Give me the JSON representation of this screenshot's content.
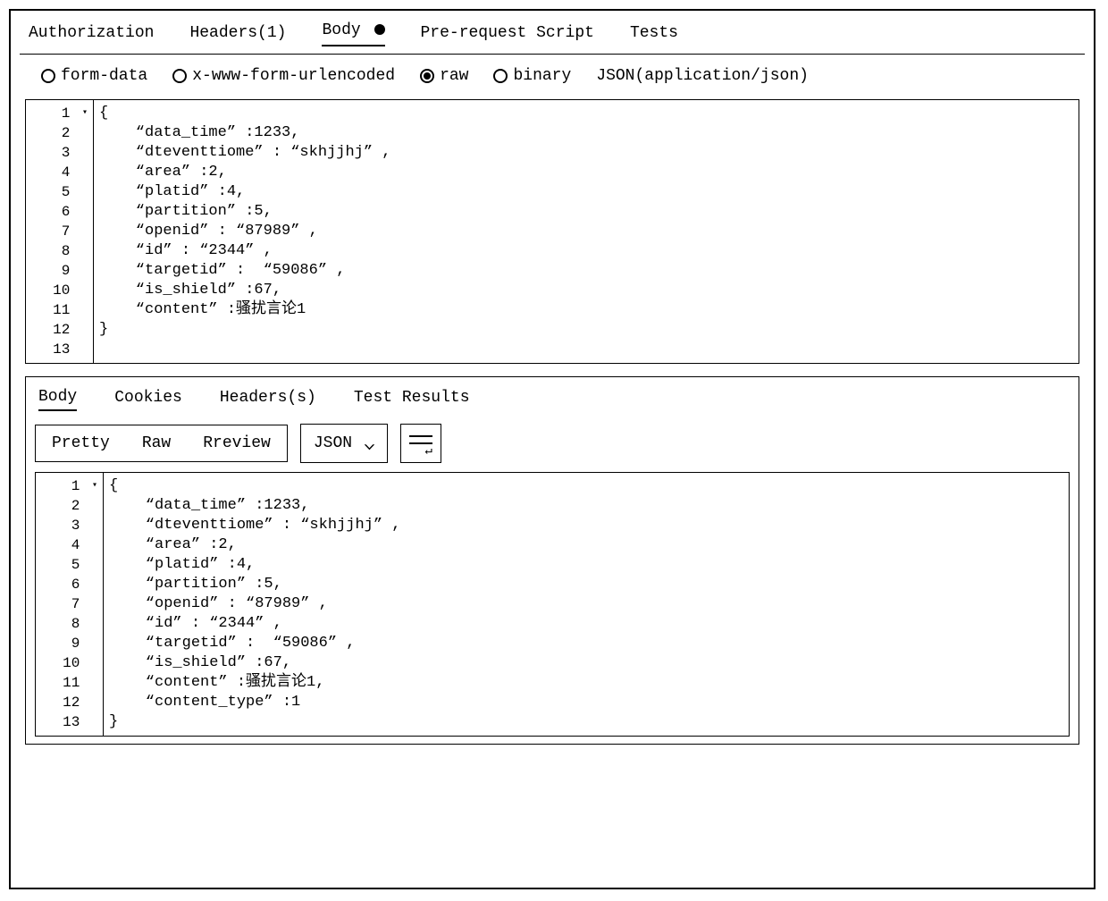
{
  "request_tabs": {
    "authorization": "Authorization",
    "headers": "Headers(1)",
    "body": "Body",
    "prerequest": "Pre-request Script",
    "tests": "Tests"
  },
  "body_types": {
    "formdata": "form-data",
    "urlencoded": "x-www-form-urlencoded",
    "raw": "raw",
    "binary": "binary",
    "content_type": "JSON(application/json)"
  },
  "request_body_lines": [
    "{",
    "    “data_time” :1233,",
    "    “dteventtiome” : “skhjjhj” ,",
    "    “area” :2,",
    "    “platid” :4,",
    "    “partition” :5,",
    "    “openid” : “87989” ,",
    "    “id” : “2344” ,",
    "    “targetid” :  “59086” ,",
    "    “is_shield” :67,",
    "    “content” :骚扰言论1",
    "}",
    ""
  ],
  "response_tabs": {
    "body": "Body",
    "cookies": "Cookies",
    "headers": "Headers(s)",
    "test_results": "Test Results"
  },
  "response_view": {
    "pretty": "Pretty",
    "raw": "Raw",
    "preview": "Rreview",
    "format": "JSON"
  },
  "response_body_lines": [
    "{",
    "    “data_time” :1233,",
    "    “dteventtiome” : “skhjjhj” ,",
    "    “area” :2,",
    "    “platid” :4,",
    "    “partition” :5,",
    "    “openid” : “87989” ,",
    "    “id” : “2344” ,",
    "    “targetid” :  “59086” ,",
    "    “is_shield” :67,",
    "    “content” :骚扰言论1,",
    "    “content_type” :1",
    "}"
  ],
  "gutter_numbers_req": [
    "1",
    "2",
    "3",
    "4",
    "5",
    "6",
    "7",
    "8",
    "9",
    "10",
    "11",
    "12",
    "13"
  ],
  "gutter_numbers_resp": [
    "1",
    "2",
    "3",
    "4",
    "5",
    "6",
    "7",
    "8",
    "9",
    "10",
    "11",
    "12",
    "13"
  ]
}
